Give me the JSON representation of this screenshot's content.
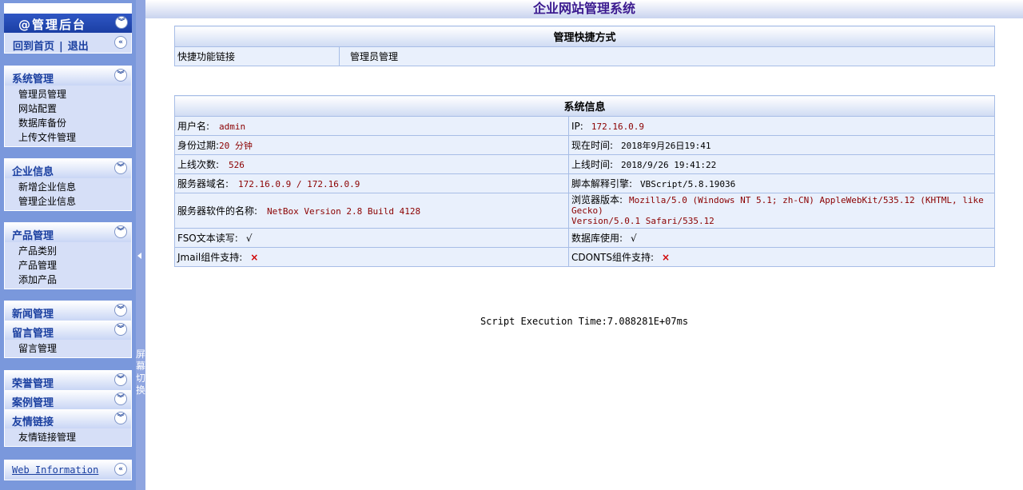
{
  "sidebar": {
    "brand_title": "@管理后台",
    "home_link": "回到首页",
    "separator": "|",
    "logout_link": "退出",
    "groups": {
      "system": {
        "title": "系统管理",
        "items": [
          "管理员管理",
          "网站配置",
          "数据库备份",
          "上传文件管理"
        ]
      },
      "company": {
        "title": "企业信息",
        "items": [
          "新增企业信息",
          "管理企业信息"
        ]
      },
      "product": {
        "title": "产品管理",
        "items": [
          "产品类别",
          "产品管理",
          "添加产品"
        ]
      },
      "news": {
        "title": "新闻管理"
      },
      "message": {
        "title": "留言管理",
        "items": [
          "留言管理"
        ]
      },
      "honor": {
        "title": "荣誉管理"
      },
      "cases": {
        "title": "案例管理"
      },
      "links": {
        "title": "友情链接",
        "items": [
          "友情链接管理"
        ]
      },
      "webinfo": {
        "title": "Web Information"
      }
    },
    "splitter_label": "屏幕切换"
  },
  "header": {
    "title": "企业网站管理系统"
  },
  "quick": {
    "title": "管理快捷方式",
    "label": "快捷功能链接",
    "link": "管理员管理"
  },
  "sysinfo": {
    "title": "系统信息",
    "username_label": "用户名:",
    "username": "admin",
    "ip_label": "IP:",
    "ip": "172.16.0.9",
    "expire_label": "身份过期:",
    "expire": "20 分钟",
    "now_label": "现在时间:",
    "now": "2018年9月26日19:41",
    "logins_label": "上线次数:",
    "logins": "526",
    "last_label": "上线时间:",
    "last": "2018/9/26 19:41:22",
    "domain_label": "服务器域名:",
    "domain": "172.16.0.9 / 172.16.0.9",
    "script_label": "脚本解释引擎:",
    "script": "VBScript/5.8.19036",
    "server_sw_label": "服务器软件的名称:",
    "server_sw": "NetBox Version 2.8 Build 4128",
    "browser_label": "浏览器版本:",
    "browser_line1": "Mozilla/5.0 (Windows NT 5.1; zh-CN) AppleWebKit/535.12 (KHTML, like Gecko)",
    "browser_line2": "Version/5.0.1 Safari/535.12",
    "fso_label": "FSO文本读写:",
    "fso": "√",
    "db_label": "数据库使用:",
    "db": "√",
    "jmail_label": "Jmail组件支持:",
    "jmail": "×",
    "cdonts_label": "CDONTS组件支持:",
    "cdonts": "×"
  },
  "footer": {
    "exec_time": "Script Execution Time:7.088281E+07ms"
  }
}
